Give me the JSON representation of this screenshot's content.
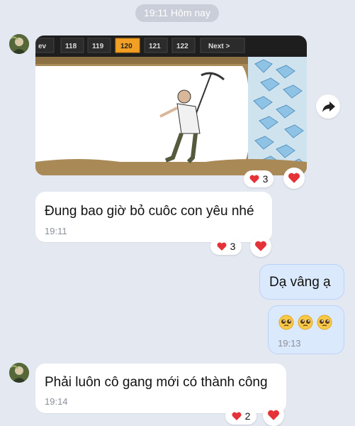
{
  "date_divider": "19:11 Hôm nay",
  "image_message": {
    "pagination": [
      "ev",
      "118",
      "119",
      "120",
      "121",
      "122",
      "Next >"
    ],
    "active_page": "120",
    "reaction_count": "3"
  },
  "messages": [
    {
      "text": "Đung bao giờ bỏ cuôc con yêu nhé",
      "time": "19:11",
      "reaction_count": "3"
    },
    {
      "text": "Dạ vâng ạ"
    },
    {
      "text": "🥹🥹🥹",
      "time": "19:13"
    },
    {
      "text": "Phải luôn cô gang mới có thành công",
      "time": "19:14",
      "reaction_count": "2"
    }
  ],
  "colors": {
    "background": "#e4e8f1",
    "outgoing_bubble": "#dbe9fd",
    "heart": "#e53238"
  }
}
